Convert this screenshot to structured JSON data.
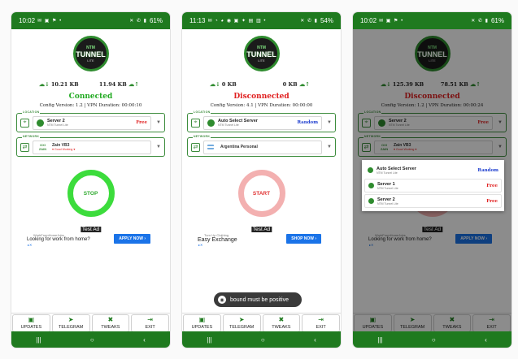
{
  "phones": [
    {
      "status": {
        "time": "10:02",
        "icons": "✉ ▣ ⚑ •",
        "sys": "✕ ✆ ▮",
        "battery": "61%"
      },
      "traffic": {
        "down": "10.21 KB",
        "up": "11.94 KB"
      },
      "state": "Connected",
      "config": "Config Version: 1.2   |   VPN Duration: 00:00:10",
      "server": {
        "tag": "LOCATION",
        "name": "Server 2",
        "sub": "NTM Tunnel Lite",
        "label": "Free"
      },
      "network": {
        "tag": "NETWORK",
        "name": "Zain VB3",
        "sub": "♥ Good Working ♥",
        "icon_top": "OXI",
        "icon_bot": "ZAIN"
      },
      "power": "STOP",
      "ad": {
        "label": "Test Ad",
        "source": "WorkFromHomeJobs",
        "headline": "Looking for work from home?",
        "cta": "APPLY NOW ›"
      }
    },
    {
      "status": {
        "time": "11:13",
        "icons": "✉ ◔ ◕ ◉ ▣ ✦ ▤ ▥ •",
        "sys": "✕ ✆ ▮",
        "battery": "54%"
      },
      "traffic": {
        "down": "0 KB",
        "up": "0 KB"
      },
      "state": "Disconnected",
      "config": "Config Version: 4.1   |   VPN Duration: 00:00:00",
      "server": {
        "tag": "LOCATION",
        "name": "Auto Select Server",
        "sub": "NTM Tunnel Lite",
        "label": "Random"
      },
      "network": {
        "tag": "NETWORK",
        "name": "Argentina Personal",
        "sub": ""
      },
      "power": "START",
      "ad": {
        "label": "Test Ad",
        "source": "Turn Up Clothing",
        "headline": "Easy Exchange",
        "cta": "SHOP NOW ›"
      }
    },
    {
      "status": {
        "time": "10:02",
        "icons": "✉ ▣ ⚑ •",
        "sys": "✕ ✆ ▮",
        "battery": "61%"
      },
      "traffic": {
        "down": "125.39 KB",
        "up": "78.51 KB"
      },
      "state": "Disconnected",
      "config": "Config Version: 1.2   |   VPN Duration: 00:00:24",
      "server": {
        "tag": "LOCATION",
        "name": "Server 2",
        "sub": "NTM Tunnel Lite",
        "label": "Free"
      },
      "network": {
        "tag": "NETWORK",
        "name": "Zain VB3",
        "sub": "♥ Good Working ♥",
        "icon_top": "OXI",
        "icon_bot": "ZAIN"
      },
      "power": "",
      "ad": {
        "label": "Test Ad",
        "source": "WorkFromHomeJobs",
        "headline": "Looking for work from home?",
        "cta": "APPLY NOW ›"
      }
    }
  ],
  "logo": {
    "top": "NTM",
    "main": "TUNNEL",
    "bottom": "LITE"
  },
  "dialog_options": [
    {
      "name": "Auto Select Server",
      "sub": "NTM Tunnel Lite",
      "label": "Random"
    },
    {
      "name": "Server 1",
      "sub": "NTM Tunnel Lite",
      "label": "Free"
    },
    {
      "name": "Server 2",
      "sub": "NTM Tunnel Lite",
      "label": "Free"
    }
  ],
  "toast": "bound must be positive",
  "tabs": [
    {
      "label": "UPDATES",
      "icon": "▣"
    },
    {
      "label": "TELEGRAM",
      "icon": "➤"
    },
    {
      "label": "TWEAKS",
      "icon": "✖"
    },
    {
      "label": "EXIT",
      "icon": "⇥"
    }
  ],
  "nav": {
    "recent": "|||",
    "home": "○",
    "back": "‹"
  },
  "colors": {
    "brand": "#1f7a1f",
    "connected": "#22aa22",
    "disconnected": "#e02020",
    "random": "#1e3ecf",
    "ad_button": "#1a73e8"
  }
}
